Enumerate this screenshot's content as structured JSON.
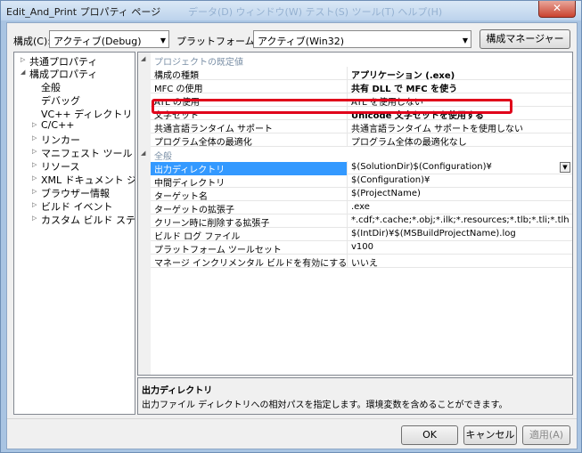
{
  "window": {
    "title": "Edit_And_Print プロパティ ページ",
    "ghost_title": "データ(D)  ウィンドウ(W)  テスト(S)  ツール(T)  ヘルプ(H)",
    "close_label": "✕"
  },
  "toolbar": {
    "config_label": "構成(C):",
    "config_value": "アクティブ(Debug)",
    "platform_label": "プラットフォーム(P):",
    "platform_value": "アクティブ(Win32)",
    "config_manager_label": "構成マネージャー(O)..."
  },
  "tree": [
    {
      "label": "共通プロパティ",
      "expander": "▷"
    },
    {
      "label": "構成プロパティ",
      "expander": "◢"
    },
    {
      "label": "全般",
      "expander": ""
    },
    {
      "label": "デバッグ",
      "expander": ""
    },
    {
      "label": "VC++ ディレクトリ",
      "expander": ""
    },
    {
      "label": "C/C++",
      "expander": "▷"
    },
    {
      "label": "リンカー",
      "expander": "▷"
    },
    {
      "label": "マニフェスト ツール",
      "expander": "▷"
    },
    {
      "label": "リソース",
      "expander": "▷"
    },
    {
      "label": "XML ドキュメント ジェネ",
      "expander": "▷"
    },
    {
      "label": "ブラウザー情報",
      "expander": "▷"
    },
    {
      "label": "ビルド イベント",
      "expander": "▷"
    },
    {
      "label": "カスタム ビルド ステップ",
      "expander": "▷"
    }
  ],
  "categories": {
    "defaults": "プロジェクトの既定値",
    "general": "全般"
  },
  "defaults_props": [
    {
      "name": "構成の種類",
      "value": "アプリケーション (.exe)"
    },
    {
      "name": "MFC の使用",
      "value": "共有 DLL で MFC を使う"
    },
    {
      "name": "ATL の使用",
      "value": "ATL を使用しない"
    },
    {
      "name": "文字セット",
      "value": "Unicode 文字セットを使用する"
    },
    {
      "name": "共通言語ランタイム サポート",
      "value": "共通言語ランタイム サポートを使用しない"
    },
    {
      "name": "プログラム全体の最適化",
      "value": "プログラム全体の最適化なし"
    }
  ],
  "general_props": [
    {
      "name": "出力ディレクトリ",
      "value": "$(SolutionDir)$(Configuration)¥"
    },
    {
      "name": "中間ディレクトリ",
      "value": "$(Configuration)¥"
    },
    {
      "name": "ターゲット名",
      "value": "$(ProjectName)"
    },
    {
      "name": "ターゲットの拡張子",
      "value": ".exe"
    },
    {
      "name": "クリーン時に削除する拡張子",
      "value": "*.cdf;*.cache;*.obj;*.ilk;*.resources;*.tlb;*.tli;*.tlh;*.tmp;*.r"
    },
    {
      "name": "ビルド ログ ファイル",
      "value": "$(IntDir)¥$(MSBuildProjectName).log"
    },
    {
      "name": "プラットフォーム ツールセット",
      "value": "v100"
    },
    {
      "name": "マネージ インクリメンタル ビルドを有効にする",
      "value": "いいえ"
    }
  ],
  "description": {
    "title": "出力ディレクトリ",
    "text": "出力ファイル ディレクトリへの相対パスを指定します。環境変数を含めることができます。"
  },
  "buttons": {
    "ok": "OK",
    "cancel": "キャンセル",
    "apply": "適用(A)"
  },
  "colors": {
    "selection": "#3399ff",
    "highlight_box": "#e0001a"
  }
}
